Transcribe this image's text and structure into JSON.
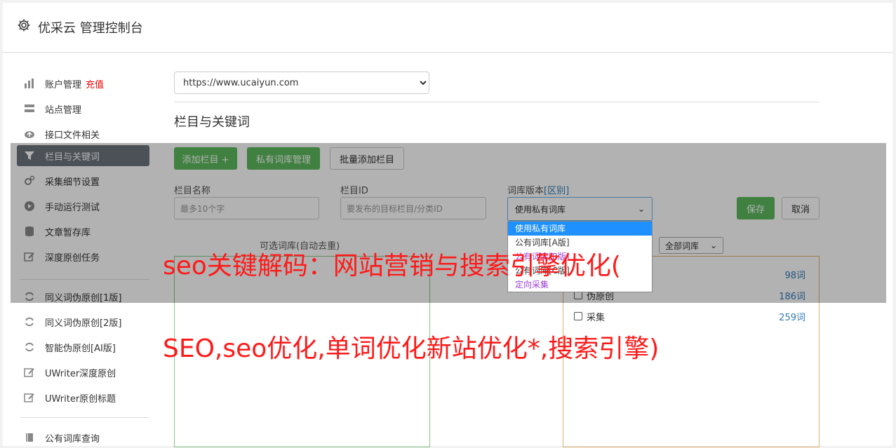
{
  "header": {
    "title": "优采云 管理控制台",
    "icon": "gear-icon"
  },
  "sidebar": {
    "items": [
      {
        "label": "账户管理",
        "icon": "bar-chart-icon",
        "badge": "充值"
      },
      {
        "label": "站点管理",
        "icon": "server-icon"
      },
      {
        "label": "接口文件相关",
        "icon": "cloud-upload-icon"
      },
      {
        "label": "栏目与关键词",
        "icon": "filter-icon",
        "active": true
      },
      {
        "label": "采集细节设置",
        "icon": "cogs-icon"
      },
      {
        "label": "手动运行测试",
        "icon": "play-circle-icon"
      },
      {
        "label": "文章暂存库",
        "icon": "database-icon"
      },
      {
        "label": "深度原创任务",
        "icon": "edit-icon"
      },
      {
        "label": "同义词伪原创[1版]",
        "icon": "refresh-icon"
      },
      {
        "label": "同义词伪原创[2版]",
        "icon": "refresh-icon"
      },
      {
        "label": "智能伪原创[AI版]",
        "icon": "refresh-icon"
      },
      {
        "label": "UWriter深度原创",
        "icon": "edit-icon"
      },
      {
        "label": "UWriter原创标题",
        "icon": "edit-icon"
      },
      {
        "label": "公有词库查询",
        "icon": "book-icon"
      }
    ]
  },
  "main": {
    "site_select": "https://www.ucaiyun.com",
    "section_title": "栏目与关键词",
    "buttons": {
      "add_column": "添加栏目 +",
      "private_dict": "私有词库管理",
      "batch_add": "批量添加栏目",
      "save": "保存",
      "cancel": "取消"
    },
    "fields": {
      "column_name_label": "栏目名称",
      "column_name_placeholder": "最多10个字",
      "column_id_label": "栏目ID",
      "column_id_placeholder": "要发布的目标栏目/分类ID",
      "dict_version_label": "词库版本",
      "dict_version_link": "[区别]",
      "dict_version_value": "使用私有词库"
    },
    "dropdown_options": [
      "使用私有词库",
      "公有词库[A版]",
      "公有词库[B版]",
      "公有词库[C版]",
      "定向采集"
    ],
    "candidate_label": "可选词库(自动去重)",
    "all_dict_select": "全部词库",
    "right_list": [
      {
        "label": "",
        "count": "98词"
      },
      {
        "label": "伪原创",
        "count": "186词"
      },
      {
        "label": "采集",
        "count": "259词"
      }
    ]
  },
  "overlay_text": {
    "line1": "seo关键解码：网站营销与搜索引擎优化(",
    "line2": "SEO,seo优化,单词优化新站优化*,搜索引擎)"
  },
  "colors": {
    "green": "#5cb85c",
    "active": "#6c757d",
    "red_text": "#ff1a1a",
    "link": "#337ab7"
  }
}
